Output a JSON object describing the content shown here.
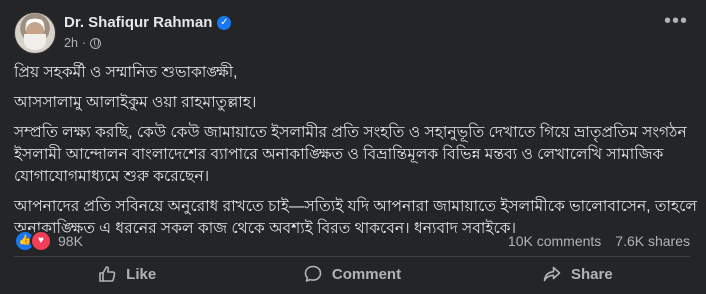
{
  "post": {
    "author": "Dr. Shafiqur Rahman",
    "time": "2h",
    "paragraphs": [
      "প্রিয় সহকর্মী ও সম্মানিত শুভাকাঙ্ক্ষী,",
      "আসসালামু আলাইকুম ওয়া রাহমাতুল্লাহ।",
      "সম্প্রতি লক্ষ্য করছি, কেউ কেউ জামায়াতে ইসলামীর প্রতি সংহতি ও সহানুভূতি দেখাতে গিয়ে ভ্রাতৃপ্রতিম সংগঠন ইসলামী আন্দোলন বাংলাদেশের ব্যাপারে অনাকাঙ্ক্ষিত ও বিভ্রান্তিমূলক বিভিন্ন মন্তব্য ও লেখালেখি সামাজিক যোগাযোগমাধ্যমে শুরু করেছেন।",
      "আপনাদের প্রতি সবিনয়ে অনুরোধ রাখতে চাই—সত্যিই যদি আপনারা জামায়াতে ইসলামীকে ভালোবাসেন, তাহলে অনাকাঙ্ক্ষিত এ ধরনের সকল কাজ থেকে অবশ্যই বিরত থাকবেন। ধন্যবাদ সবাইকে।"
    ],
    "reaction_count": "98K",
    "comments": "10K comments",
    "shares": "7.6K shares"
  },
  "actions": {
    "like": "Like",
    "comment": "Comment",
    "share": "Share"
  },
  "colors": {
    "background": "#242526",
    "text": "#e4e6eb",
    "muted": "#b0b3b8",
    "verified": "#1877f2",
    "love": "#f33e58"
  }
}
